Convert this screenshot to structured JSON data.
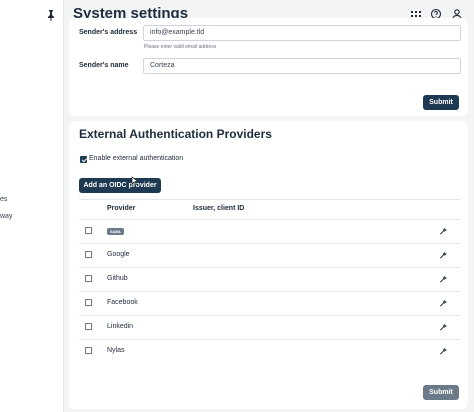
{
  "sidebar": {
    "items": [
      {
        "label": "es"
      },
      {
        "label": "way"
      }
    ]
  },
  "header": {
    "title": "System settings"
  },
  "email_settings": {
    "sender_address_label": "Sender's address",
    "sender_address_value": "info@example.tld",
    "sender_address_help": "Please enter valid email address",
    "sender_name_label": "Sender's name",
    "sender_name_value": "Corteza",
    "submit_label": "Submit"
  },
  "external_auth": {
    "title": "External Authentication Providers",
    "enable_label": "Enable external authentication",
    "enable_checked": true,
    "add_oidc_label": "Add an OIDC provider",
    "columns": [
      "Provider",
      "Issuer, client ID"
    ],
    "providers": [
      {
        "name": "",
        "badge": "SAML",
        "checked": false
      },
      {
        "name": "Google",
        "badge": "",
        "checked": false
      },
      {
        "name": "Github",
        "badge": "",
        "checked": false
      },
      {
        "name": "Facebook",
        "badge": "",
        "checked": false
      },
      {
        "name": "Linkedin",
        "badge": "",
        "checked": false
      },
      {
        "name": "Nylas",
        "badge": "",
        "checked": false
      }
    ],
    "submit_label": "Submit"
  },
  "colors": {
    "primary": "#1e3a52",
    "disabled": "#6b7a88",
    "background": "#f3f4f6"
  }
}
